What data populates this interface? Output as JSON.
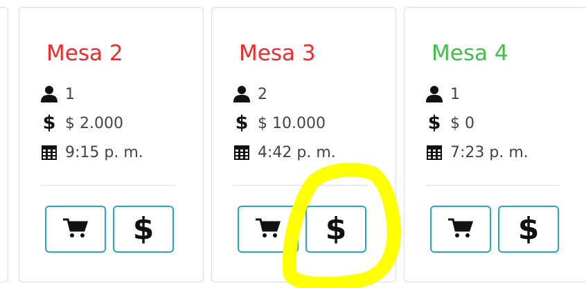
{
  "tables": [
    {
      "title": "Mesa 2",
      "title_color": "#ee2b2b",
      "guests": "1",
      "amount": "$ 2.000",
      "time": "9:15 p. m."
    },
    {
      "title": "Mesa 3",
      "title_color": "#ee2b2b",
      "guests": "2",
      "amount": "$ 10.000",
      "time": "4:42 p. m."
    },
    {
      "title": "Mesa 4",
      "title_color": "#3fbf4a",
      "guests": "1",
      "amount": "$ 0",
      "time": "7:23 p. m."
    }
  ],
  "icons": {
    "guests": "person-icon",
    "amount": "dollar-icon",
    "time": "calendar-icon",
    "cart_button": "cart-icon",
    "pay_button": "dollar-icon"
  },
  "glyphs": {
    "dollar": "$"
  },
  "colors": {
    "button_border": "#2ba4c4",
    "highlight": "#ffff00"
  }
}
